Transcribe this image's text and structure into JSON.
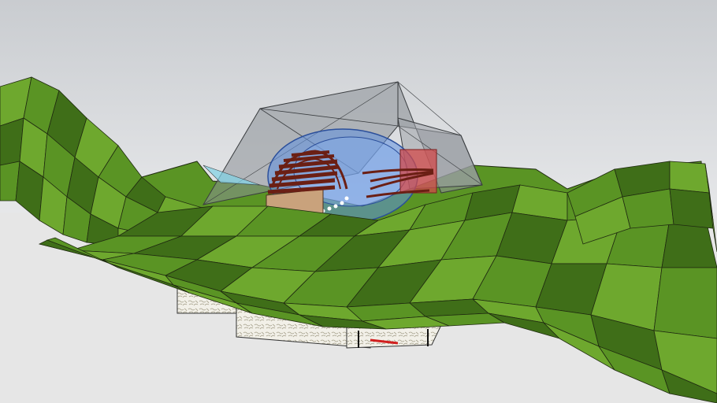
{
  "scene": {
    "description_colors": {
      "sky_top": "#c9ccd0",
      "sky_bottom": "#e9eaec",
      "ground": "#e6e6e6",
      "terrain_light": "#6ea82e",
      "terrain_mid": "#5a9424",
      "terrain_dark": "#3f6e18",
      "terrain_edge": "#1f2a10",
      "canopy": "#8a8f95",
      "dome_blue": "#5f8fe0",
      "dome_red": "#d24a4a",
      "timber": "#6b1f14",
      "wall_tan": "#c9a27c",
      "foundation": "#f2f0e8",
      "pipe_red": "#d11f1f"
    },
    "objects": [
      {
        "name": "terrain",
        "icon": "terrain-mesh"
      },
      {
        "name": "canopy",
        "icon": "glass-canopy"
      },
      {
        "name": "dome",
        "icon": "glass-dome"
      },
      {
        "name": "timber-roof",
        "icon": "timber-ribs"
      },
      {
        "name": "foundation",
        "icon": "rubble-foundation"
      }
    ]
  }
}
